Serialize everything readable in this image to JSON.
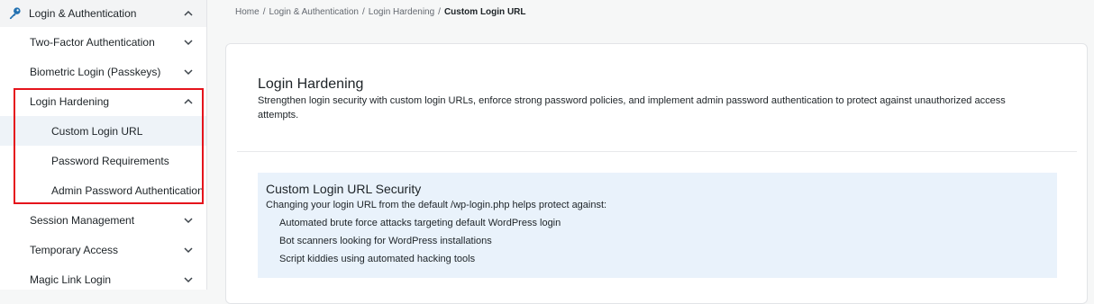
{
  "sidebar": {
    "top": {
      "label": "Login & Authentication",
      "icon": "key-icon"
    },
    "items": [
      {
        "label": "Two-Factor Authentication",
        "icon": "chevron-down-icon"
      },
      {
        "label": "Biometric Login (Passkeys)",
        "icon": "chevron-down-icon"
      },
      {
        "label": "Login Hardening",
        "icon": "chevron-up-icon"
      },
      {
        "label": "Session Management",
        "icon": "chevron-down-icon"
      },
      {
        "label": "Temporary Access",
        "icon": "chevron-down-icon"
      },
      {
        "label": "Magic Link Login",
        "icon": "chevron-down-icon"
      }
    ],
    "children": [
      {
        "label": "Custom Login URL",
        "active": true
      },
      {
        "label": "Password Requirements"
      },
      {
        "label": "Admin Password Authentication"
      }
    ],
    "highlight_color": "#e5141c"
  },
  "breadcrumb": {
    "items": [
      "Home",
      "Login & Authentication",
      "Login Hardening"
    ],
    "separator": "/",
    "current": "Custom Login URL"
  },
  "panel": {
    "title": "Login Hardening",
    "description": "Strengthen login security with custom login URLs, enforce strong password policies, and implement admin password authentication to protect against unauthorized access attempts."
  },
  "infobox": {
    "title": "Custom Login URL Security",
    "subtitle": "Changing your login URL from the default /wp-login.php helps protect against:",
    "items": [
      "Automated brute force attacks targeting default WordPress login",
      "Bot scanners looking for WordPress installations",
      "Script kiddies using automated hacking tools"
    ],
    "background": "#e9f2fb"
  }
}
